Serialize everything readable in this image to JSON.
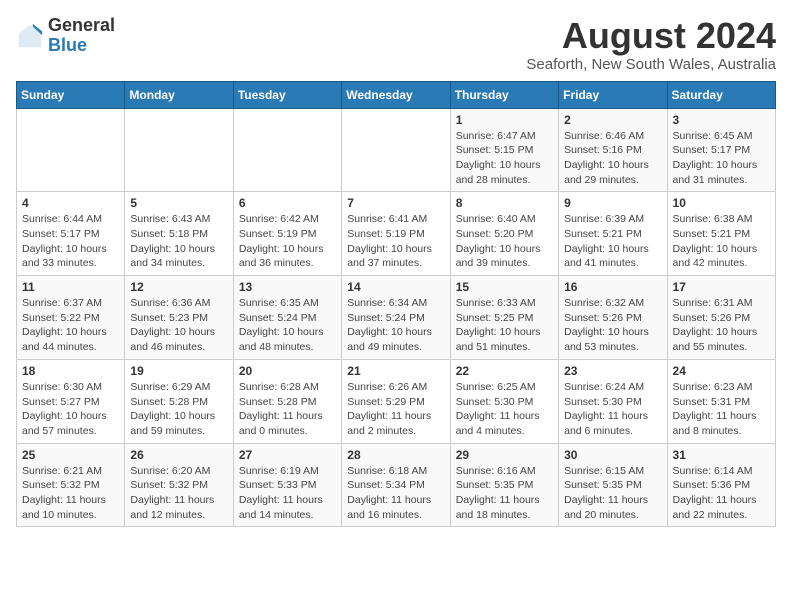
{
  "logo": {
    "general": "General",
    "blue": "Blue"
  },
  "title": "August 2024",
  "subtitle": "Seaforth, New South Wales, Australia",
  "days_of_week": [
    "Sunday",
    "Monday",
    "Tuesday",
    "Wednesday",
    "Thursday",
    "Friday",
    "Saturday"
  ],
  "weeks": [
    [
      {
        "day": "",
        "info": ""
      },
      {
        "day": "",
        "info": ""
      },
      {
        "day": "",
        "info": ""
      },
      {
        "day": "",
        "info": ""
      },
      {
        "day": "1",
        "info": "Sunrise: 6:47 AM\nSunset: 5:15 PM\nDaylight: 10 hours and 28 minutes."
      },
      {
        "day": "2",
        "info": "Sunrise: 6:46 AM\nSunset: 5:16 PM\nDaylight: 10 hours and 29 minutes."
      },
      {
        "day": "3",
        "info": "Sunrise: 6:45 AM\nSunset: 5:17 PM\nDaylight: 10 hours and 31 minutes."
      }
    ],
    [
      {
        "day": "4",
        "info": "Sunrise: 6:44 AM\nSunset: 5:17 PM\nDaylight: 10 hours and 33 minutes."
      },
      {
        "day": "5",
        "info": "Sunrise: 6:43 AM\nSunset: 5:18 PM\nDaylight: 10 hours and 34 minutes."
      },
      {
        "day": "6",
        "info": "Sunrise: 6:42 AM\nSunset: 5:19 PM\nDaylight: 10 hours and 36 minutes."
      },
      {
        "day": "7",
        "info": "Sunrise: 6:41 AM\nSunset: 5:19 PM\nDaylight: 10 hours and 37 minutes."
      },
      {
        "day": "8",
        "info": "Sunrise: 6:40 AM\nSunset: 5:20 PM\nDaylight: 10 hours and 39 minutes."
      },
      {
        "day": "9",
        "info": "Sunrise: 6:39 AM\nSunset: 5:21 PM\nDaylight: 10 hours and 41 minutes."
      },
      {
        "day": "10",
        "info": "Sunrise: 6:38 AM\nSunset: 5:21 PM\nDaylight: 10 hours and 42 minutes."
      }
    ],
    [
      {
        "day": "11",
        "info": "Sunrise: 6:37 AM\nSunset: 5:22 PM\nDaylight: 10 hours and 44 minutes."
      },
      {
        "day": "12",
        "info": "Sunrise: 6:36 AM\nSunset: 5:23 PM\nDaylight: 10 hours and 46 minutes."
      },
      {
        "day": "13",
        "info": "Sunrise: 6:35 AM\nSunset: 5:24 PM\nDaylight: 10 hours and 48 minutes."
      },
      {
        "day": "14",
        "info": "Sunrise: 6:34 AM\nSunset: 5:24 PM\nDaylight: 10 hours and 49 minutes."
      },
      {
        "day": "15",
        "info": "Sunrise: 6:33 AM\nSunset: 5:25 PM\nDaylight: 10 hours and 51 minutes."
      },
      {
        "day": "16",
        "info": "Sunrise: 6:32 AM\nSunset: 5:26 PM\nDaylight: 10 hours and 53 minutes."
      },
      {
        "day": "17",
        "info": "Sunrise: 6:31 AM\nSunset: 5:26 PM\nDaylight: 10 hours and 55 minutes."
      }
    ],
    [
      {
        "day": "18",
        "info": "Sunrise: 6:30 AM\nSunset: 5:27 PM\nDaylight: 10 hours and 57 minutes."
      },
      {
        "day": "19",
        "info": "Sunrise: 6:29 AM\nSunset: 5:28 PM\nDaylight: 10 hours and 59 minutes."
      },
      {
        "day": "20",
        "info": "Sunrise: 6:28 AM\nSunset: 5:28 PM\nDaylight: 11 hours and 0 minutes."
      },
      {
        "day": "21",
        "info": "Sunrise: 6:26 AM\nSunset: 5:29 PM\nDaylight: 11 hours and 2 minutes."
      },
      {
        "day": "22",
        "info": "Sunrise: 6:25 AM\nSunset: 5:30 PM\nDaylight: 11 hours and 4 minutes."
      },
      {
        "day": "23",
        "info": "Sunrise: 6:24 AM\nSunset: 5:30 PM\nDaylight: 11 hours and 6 minutes."
      },
      {
        "day": "24",
        "info": "Sunrise: 6:23 AM\nSunset: 5:31 PM\nDaylight: 11 hours and 8 minutes."
      }
    ],
    [
      {
        "day": "25",
        "info": "Sunrise: 6:21 AM\nSunset: 5:32 PM\nDaylight: 11 hours and 10 minutes."
      },
      {
        "day": "26",
        "info": "Sunrise: 6:20 AM\nSunset: 5:32 PM\nDaylight: 11 hours and 12 minutes."
      },
      {
        "day": "27",
        "info": "Sunrise: 6:19 AM\nSunset: 5:33 PM\nDaylight: 11 hours and 14 minutes."
      },
      {
        "day": "28",
        "info": "Sunrise: 6:18 AM\nSunset: 5:34 PM\nDaylight: 11 hours and 16 minutes."
      },
      {
        "day": "29",
        "info": "Sunrise: 6:16 AM\nSunset: 5:35 PM\nDaylight: 11 hours and 18 minutes."
      },
      {
        "day": "30",
        "info": "Sunrise: 6:15 AM\nSunset: 5:35 PM\nDaylight: 11 hours and 20 minutes."
      },
      {
        "day": "31",
        "info": "Sunrise: 6:14 AM\nSunset: 5:36 PM\nDaylight: 11 hours and 22 minutes."
      }
    ]
  ]
}
